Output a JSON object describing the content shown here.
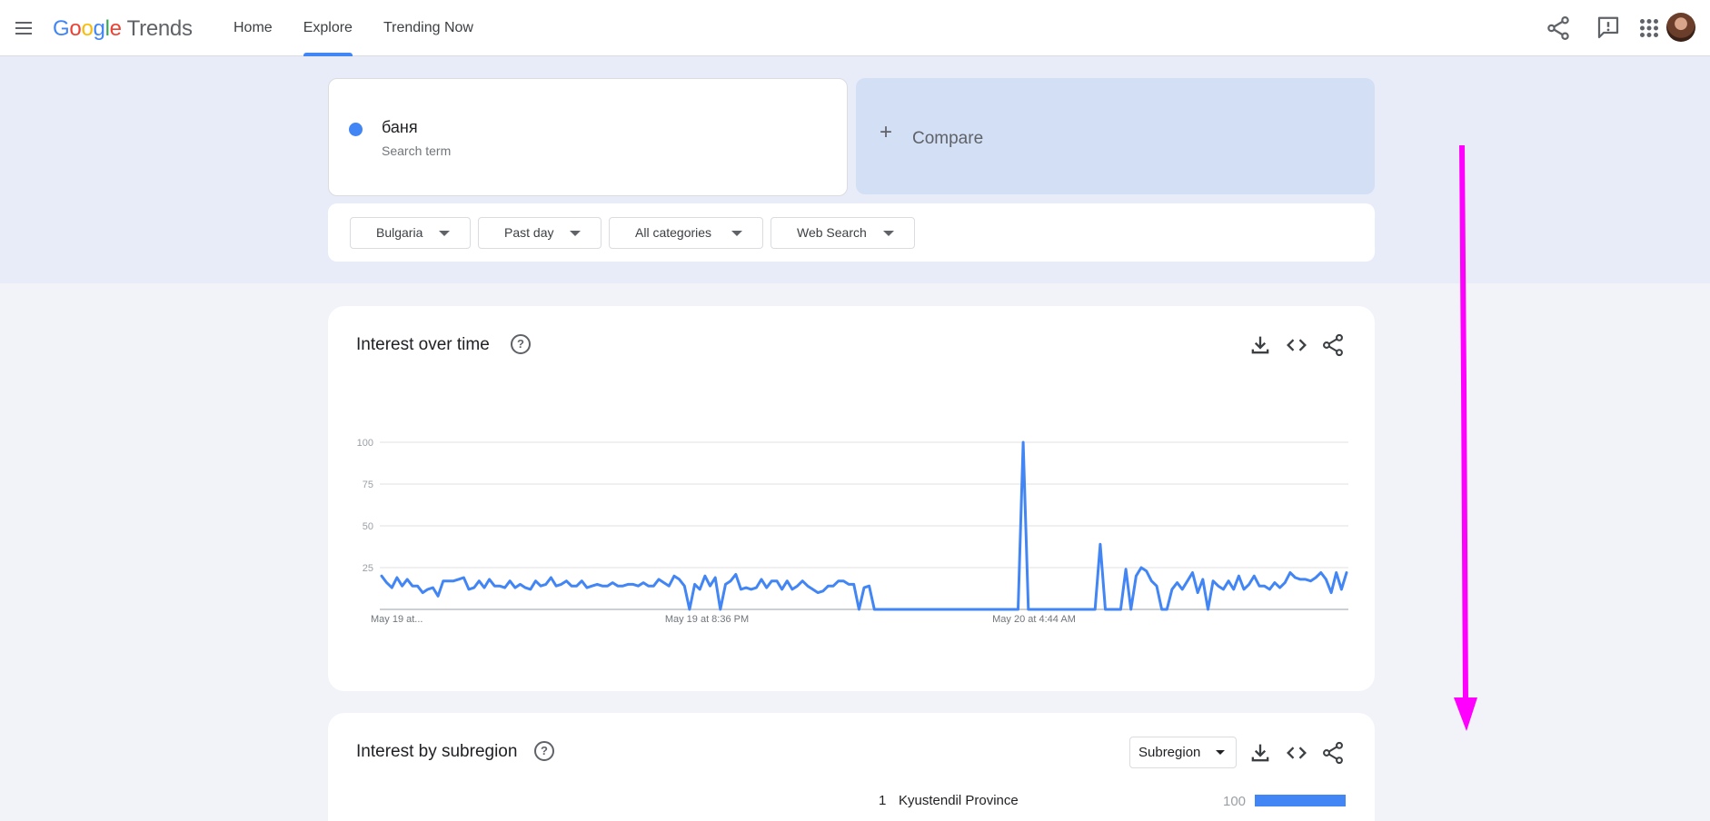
{
  "app": {
    "logo_google": "Google",
    "logo_product": "Trends"
  },
  "nav": {
    "items": [
      {
        "label": "Home"
      },
      {
        "label": "Explore",
        "active": true
      },
      {
        "label": "Trending Now"
      }
    ]
  },
  "search": {
    "term": "баня",
    "term_type": "Search term",
    "term_color": "#4285f4",
    "compare_label": "Compare"
  },
  "filters": {
    "region": "Bulgaria",
    "time": "Past day",
    "category": "All categories",
    "property": "Web Search"
  },
  "interest_over_time": {
    "title": "Interest over time"
  },
  "interest_by_subregion": {
    "title": "Interest by subregion",
    "resolution": "Subregion",
    "rows": [
      {
        "rank": "1",
        "name": "Kyustendil Province",
        "value": "100",
        "value_num": 100
      }
    ]
  },
  "chart_data": {
    "type": "line",
    "series": [
      {
        "color": "#4285f4",
        "values": [
          20,
          16,
          13,
          19,
          14,
          18,
          14,
          14,
          10,
          12,
          13,
          8,
          17,
          17,
          17,
          18,
          19,
          12,
          13,
          17,
          13,
          18,
          14,
          14,
          13,
          17,
          13,
          15,
          13,
          12,
          17,
          14,
          15,
          19,
          14,
          15,
          17,
          14,
          14,
          17,
          13,
          14,
          15,
          14,
          14,
          16,
          14,
          14,
          15,
          15,
          14,
          16,
          14,
          14,
          18,
          16,
          14,
          20,
          18,
          14,
          0,
          15,
          12,
          20,
          14,
          19,
          0,
          15,
          17,
          21,
          12,
          13,
          12,
          13,
          18,
          13,
          17,
          17,
          12,
          17,
          12,
          14,
          17,
          14,
          12,
          10,
          11,
          14,
          14,
          17,
          17,
          15,
          15,
          0,
          13,
          14,
          0,
          0,
          0,
          0,
          0,
          0,
          0,
          0,
          0,
          0,
          0,
          0,
          0,
          0,
          0,
          0,
          0,
          0,
          0,
          0,
          0,
          0,
          0,
          0,
          0,
          0,
          0,
          0,
          0,
          100,
          0,
          0,
          0,
          0,
          0,
          0,
          0,
          0,
          0,
          0,
          0,
          0,
          0,
          0,
          39,
          0,
          0,
          0,
          0,
          24,
          0,
          20,
          25,
          23,
          17,
          14,
          0,
          0,
          12,
          16,
          12,
          17,
          22,
          10,
          18,
          0,
          17,
          14,
          12,
          17,
          12,
          20,
          12,
          15,
          20,
          14,
          14,
          12,
          16,
          13,
          16,
          22,
          19,
          18,
          18,
          17,
          19,
          22,
          18,
          10,
          22,
          12,
          22
        ]
      }
    ],
    "x_tick_labels": [
      "May 19 at...",
      "May 19 at 8:36 PM",
      "May 20 at 4:44 AM"
    ],
    "y_ticks": [
      25,
      50,
      75,
      100
    ],
    "ylim": [
      0,
      100
    ],
    "grid": true
  },
  "colors": {
    "accent": "#4285f4",
    "annotation_arrow": "#ff00ff"
  }
}
